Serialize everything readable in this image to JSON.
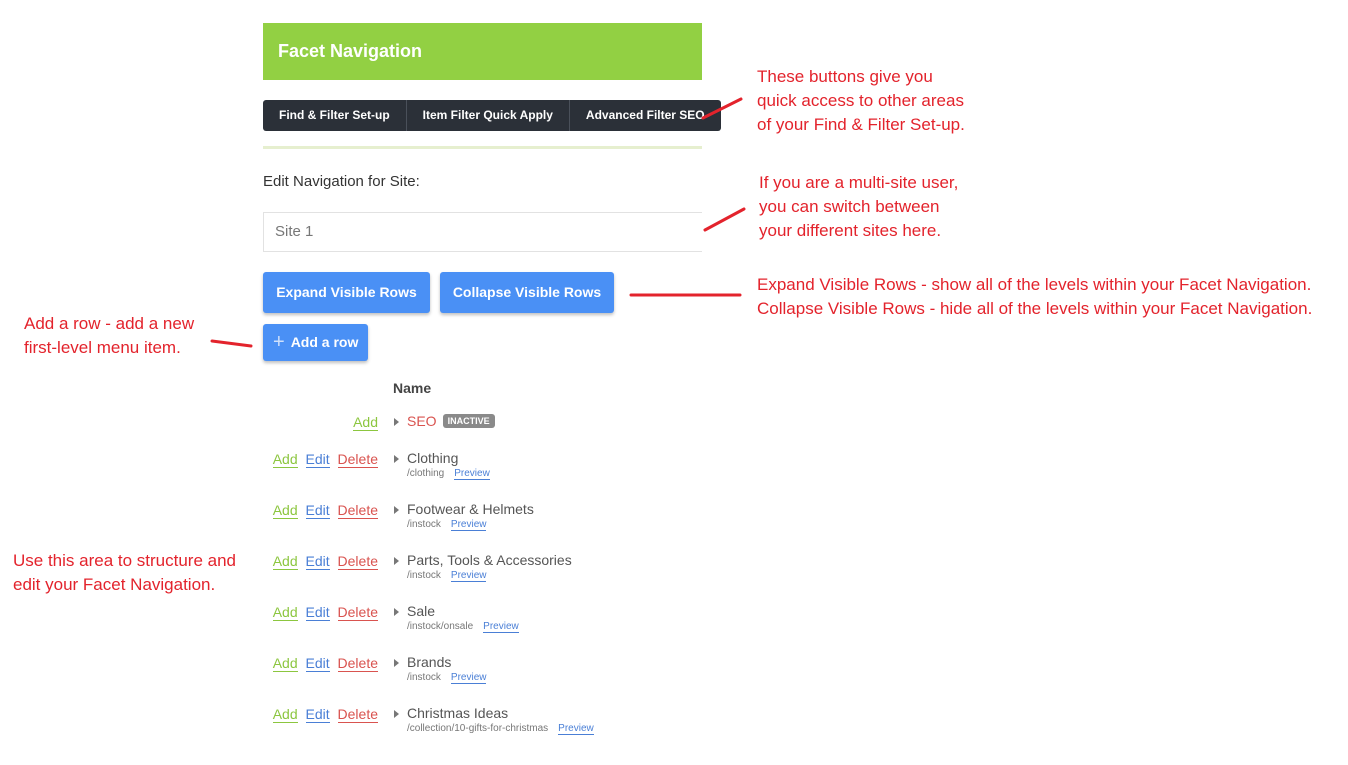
{
  "header": {
    "title": "Facet Navigation"
  },
  "toolbar": {
    "buttons": [
      "Find & Filter Set-up",
      "Item Filter Quick Apply",
      "Advanced Filter SEO"
    ]
  },
  "site": {
    "label": "Edit Navigation for Site:",
    "value": "Site 1"
  },
  "actions": {
    "expand": "Expand Visible Rows",
    "collapse": "Collapse Visible Rows",
    "add_row": "Add a row"
  },
  "table": {
    "column_name": "Name",
    "action_labels": {
      "add": "Add",
      "edit": "Edit",
      "delete": "Delete"
    },
    "preview_label": "Preview",
    "rows": [
      {
        "title": "SEO",
        "badge": "INACTIVE",
        "path": ""
      },
      {
        "title": "Clothing",
        "path": "/clothing"
      },
      {
        "title": "Footwear & Helmets",
        "path": "/instock"
      },
      {
        "title": "Parts, Tools & Accessories",
        "path": "/instock"
      },
      {
        "title": "Sale",
        "path": "/instock/onsale"
      },
      {
        "title": "Brands",
        "path": "/instock"
      },
      {
        "title": "Christmas Ideas",
        "path": "/collection/10-gifts-for-christmas"
      }
    ]
  },
  "annotations": {
    "toolbar_note": [
      "These buttons give you",
      "quick access to other areas",
      "of your Find & Filter Set-up."
    ],
    "site_note": [
      "If you are a multi-site user,",
      "you can switch between",
      "your different sites here."
    ],
    "expand_note": [
      "Expand Visible Rows - show all of the levels within your Facet Navigation.",
      "Collapse Visible Rows - hide all of the levels within your Facet Navigation."
    ],
    "add_row_note": [
      "Add a row - add a new",
      "first-level menu item."
    ],
    "structure_note": [
      "Use this area to structure and",
      "edit your Facet Navigation."
    ]
  },
  "colors": {
    "header_green": "#92d043",
    "toolbar_dark": "#2b3038",
    "button_blue": "#4a90f5",
    "annotation_red": "#e3232c"
  }
}
